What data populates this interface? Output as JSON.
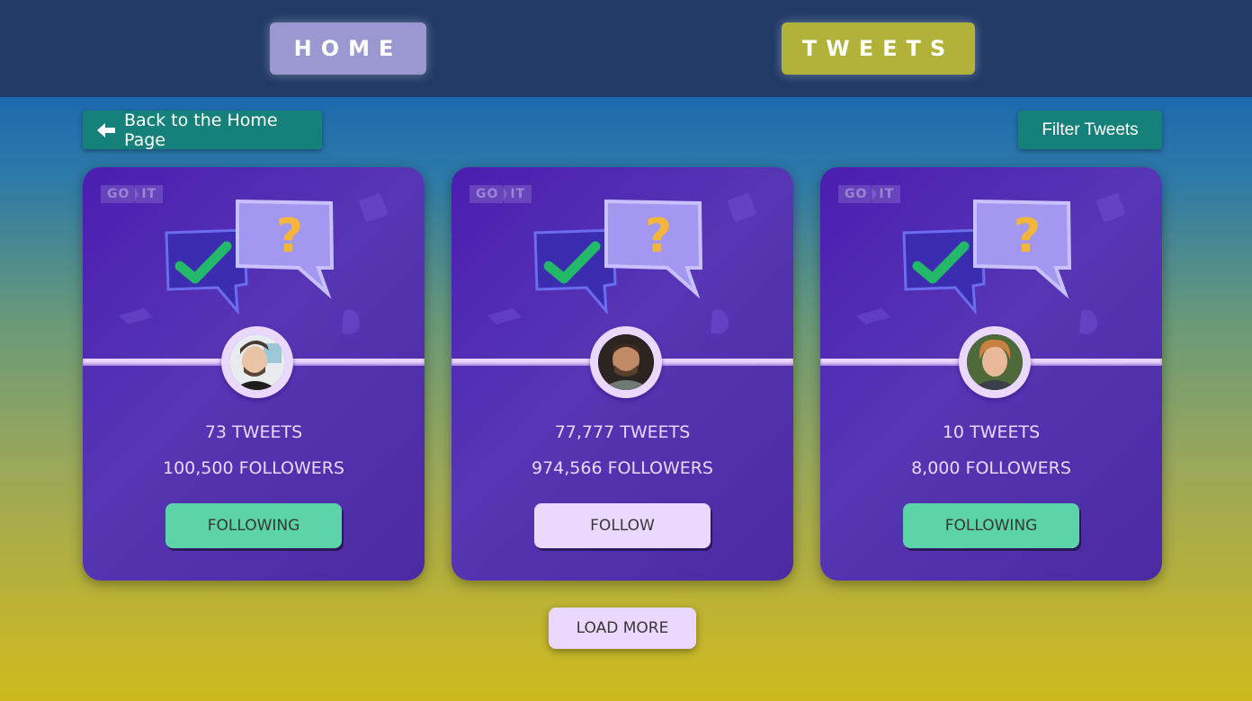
{
  "nav": {
    "home_label": "HOME",
    "tweets_label": "TWEETS"
  },
  "toolbar": {
    "back_label": "Back to the Home Page",
    "filter_label": "Filter Tweets"
  },
  "colors": {
    "following": "#5cd3a8",
    "follow": "#ebd8ff",
    "accent_teal": "#16807a",
    "card": "#5736a3"
  },
  "cards": [
    {
      "logo_go": "GO",
      "logo_it": "IT",
      "tweets": "73 TWEETS",
      "followers": "100,500 FOLLOWERS",
      "button_label": "FOLLOWING",
      "state": "following"
    },
    {
      "logo_go": "GO",
      "logo_it": "IT",
      "tweets": "77,777 TWEETS",
      "followers": "974,566 FOLLOWERS",
      "button_label": "FOLLOW",
      "state": "follow"
    },
    {
      "logo_go": "GO",
      "logo_it": "IT",
      "tweets": "10 TWEETS",
      "followers": "8,000 FOLLOWERS",
      "button_label": "FOLLOWING",
      "state": "following"
    }
  ],
  "load_more_label": "LOAD MORE"
}
